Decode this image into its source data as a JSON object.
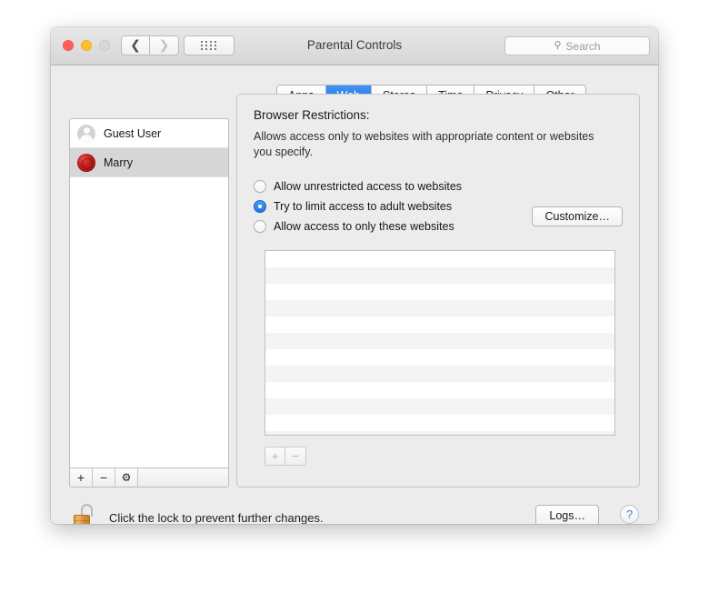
{
  "window": {
    "title": "Parental Controls",
    "traffic_lights": [
      "close",
      "minimize",
      "zoom"
    ],
    "nav": {
      "back_icon": "chevron-left-icon",
      "forward_icon": "chevron-right-icon",
      "grid_icon": "show-all-grid-icon"
    },
    "search": {
      "placeholder": "Search",
      "icon": "search-icon"
    }
  },
  "tabs": [
    {
      "label": "Apps",
      "active": false
    },
    {
      "label": "Web",
      "active": true
    },
    {
      "label": "Stores",
      "active": false
    },
    {
      "label": "Time",
      "active": false
    },
    {
      "label": "Privacy",
      "active": false
    },
    {
      "label": "Other",
      "active": false
    }
  ],
  "sidebar": {
    "users": [
      {
        "name": "Guest User",
        "avatar": "guest-avatar-icon",
        "selected": false
      },
      {
        "name": "Marry",
        "avatar": "user-avatar-icon",
        "selected": true
      }
    ],
    "footer": {
      "add_label": "+",
      "remove_label": "−",
      "gear_icon": "gear-icon",
      "gear_label": "⚙"
    }
  },
  "panel": {
    "heading": "Browser Restrictions:",
    "description": "Allows access only to websites with appropriate content or websites you specify.",
    "options": [
      {
        "label": "Allow unrestricted access to websites",
        "selected": false
      },
      {
        "label": "Try to limit access to adult websites",
        "selected": true
      },
      {
        "label": "Allow access to only these websites",
        "selected": false
      }
    ],
    "customize_label": "Customize…",
    "website_list": {
      "rows": 11,
      "items": []
    },
    "list_footer": {
      "add_label": "+",
      "remove_label": "−"
    }
  },
  "bottom": {
    "lock_icon": "unlocked-padlock-icon",
    "lock_text": "Click the lock to prevent further changes.",
    "logs_label": "Logs…",
    "help_label": "?"
  },
  "colors": {
    "accent_blue": "#1f75e3",
    "window_chrome": "#ececec",
    "selection_gray": "#d6d6d6",
    "stripe_gray": "#f4f4f4",
    "lock_gold": "#e09a47",
    "avatar_red": "#c21f1c",
    "help_blue": "#3f7fd8"
  }
}
